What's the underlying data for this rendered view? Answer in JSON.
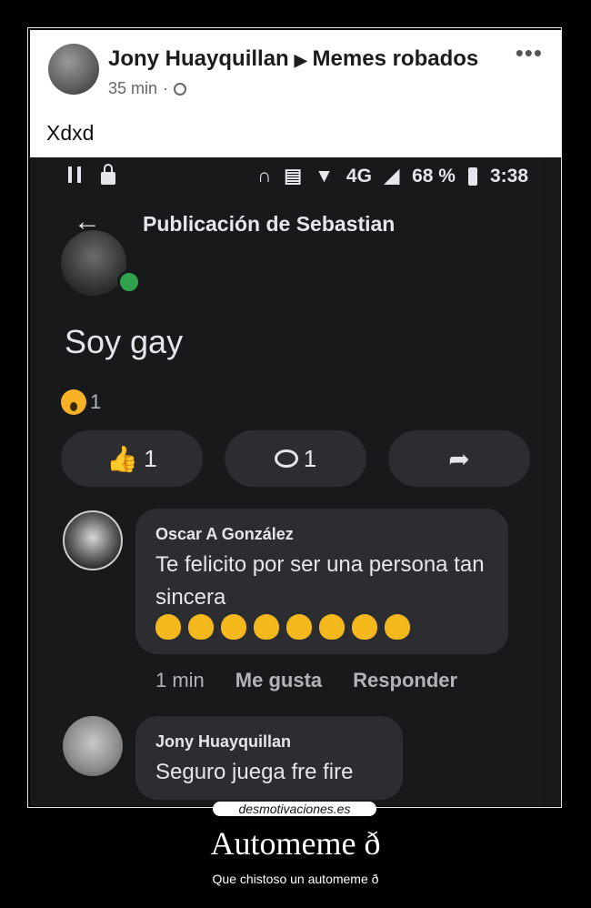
{
  "post": {
    "author": "Jony Huayquillan",
    "arrow": "▶",
    "group": "Memes robados",
    "time": "35 min",
    "dot": "·",
    "more": "•••",
    "text": "Xdxd"
  },
  "phone": {
    "status": {
      "network": "4G",
      "battery": "68 %",
      "time": "3:38"
    },
    "back": "←",
    "title": "Publicación de Sebastian",
    "body": "Soy gay",
    "reaction_count": "1",
    "like_count": "1",
    "comment_count": "1",
    "comments": [
      {
        "author": "Oscar A González",
        "text": "Te felicito por ser una persona tan sincera",
        "time": "1 min",
        "like_label": "Me gusta",
        "reply_label": "Responder"
      },
      {
        "author": "Jony Huayquillan",
        "text": "Seguro juega fre fire"
      }
    ]
  },
  "footer": {
    "site": "desmotivaciones.es",
    "title": "Automeme ð",
    "subtitle": "Que chistoso un automeme ð"
  }
}
